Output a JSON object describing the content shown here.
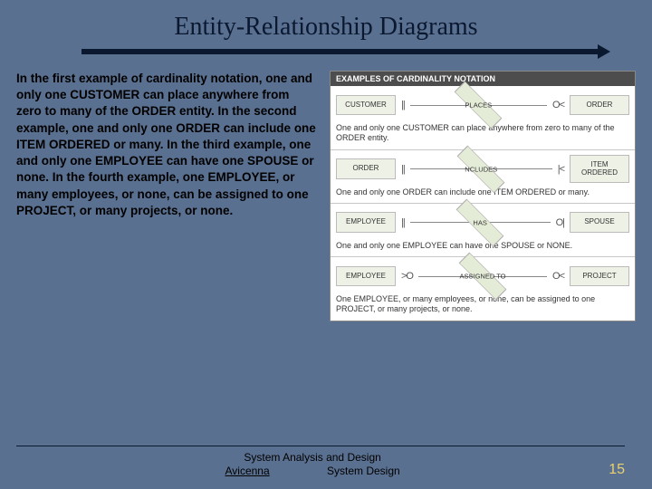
{
  "title": "Entity-Relationship Diagrams",
  "body_text": "In the first example of cardinality notation, one and only one CUSTOMER can place anywhere from zero to many of the ORDER entity. In the second example, one and only one ORDER can include one ITEM ORDERED or many. In the third example, one and only one EMPLOYEE can have one SPOUSE or none. In the fourth example, one EMPLOYEE, or many employees, or none, can be assigned to one PROJECT, or many projects, or none.",
  "figure": {
    "header": "EXAMPLES OF CARDINALITY NOTATION",
    "rows": [
      {
        "left_entity": "CUSTOMER",
        "left_notation": "||",
        "relationship": "PLACES",
        "right_notation": "O<",
        "right_entity": "ORDER",
        "caption": "One and only one CUSTOMER can place anywhere from zero to many of the ORDER entity."
      },
      {
        "left_entity": "ORDER",
        "left_notation": "||",
        "relationship": "NCLUDES",
        "right_notation": "|<",
        "right_entity": "ITEM ORDERED",
        "caption": "One and only one ORDER can include one ITEM ORDERED or many."
      },
      {
        "left_entity": "EMPLOYEE",
        "left_notation": "||",
        "relationship": "HAS",
        "right_notation": "O|",
        "right_entity": "SPOUSE",
        "caption": "One and only one EMPLOYEE can have one SPOUSE or NONE."
      },
      {
        "left_entity": "EMPLOYEE",
        "left_notation": ">O",
        "relationship": "ASSIGNED TO",
        "right_notation": "O<",
        "right_entity": "PROJECT",
        "caption": "One EMPLOYEE, or many employees, or none, can be assigned to one PROJECT, or many projects, or none."
      }
    ]
  },
  "footer": {
    "line1": "System Analysis and Design",
    "author": "Avicenna",
    "line2": "System Design",
    "page": "15"
  }
}
